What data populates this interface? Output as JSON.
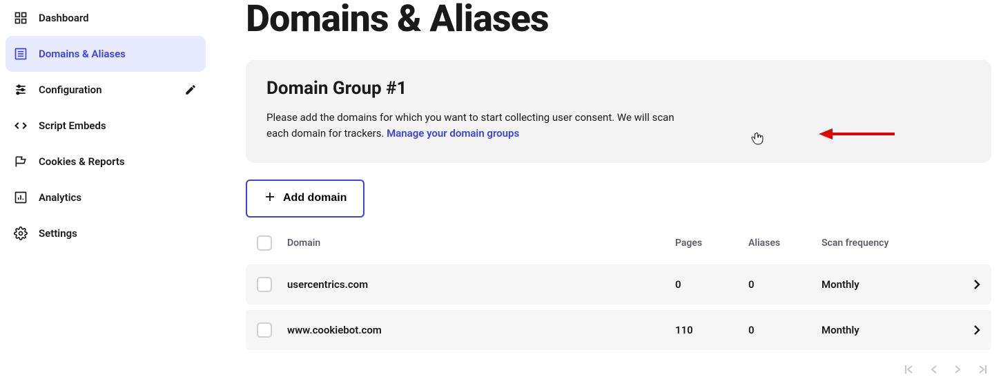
{
  "sidebar": {
    "items": [
      {
        "label": "Dashboard"
      },
      {
        "label": "Domains & Aliases"
      },
      {
        "label": "Configuration"
      },
      {
        "label": "Script Embeds"
      },
      {
        "label": "Cookies & Reports"
      },
      {
        "label": "Analytics"
      },
      {
        "label": "Settings"
      }
    ]
  },
  "page": {
    "title": "Domains & Aliases"
  },
  "group": {
    "title": "Domain Group #1",
    "desc_a": "Please add the domains for which you want to start collecting user consent. We will scan each domain for trackers. ",
    "manage_link": "Manage your domain groups"
  },
  "actions": {
    "add_domain": "Add domain"
  },
  "table": {
    "headers": {
      "domain": "Domain",
      "pages": "Pages",
      "aliases": "Aliases",
      "freq": "Scan frequency"
    },
    "rows": [
      {
        "domain": "usercentrics.com",
        "pages": "0",
        "aliases": "0",
        "freq": "Monthly"
      },
      {
        "domain": "www.cookiebot.com",
        "pages": "110",
        "aliases": "0",
        "freq": "Monthly"
      }
    ]
  }
}
